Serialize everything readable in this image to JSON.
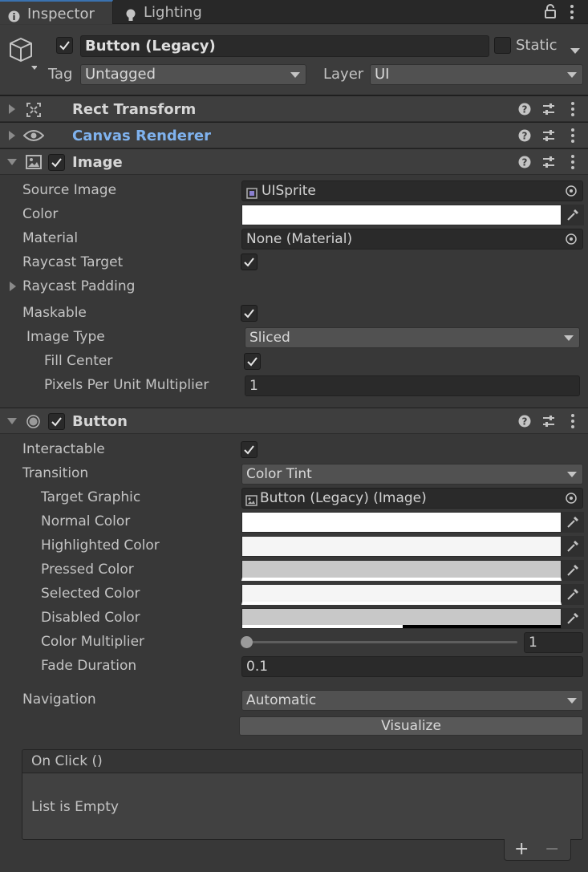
{
  "tabs": [
    {
      "label": "Inspector",
      "icon": "info-icon",
      "active": true
    },
    {
      "label": "Lighting",
      "icon": "bulb-icon",
      "active": false
    }
  ],
  "object": {
    "name": "Button (Legacy)",
    "static_label": "Static",
    "tag_label": "Tag",
    "tag_value": "Untagged",
    "layer_label": "Layer",
    "layer_value": "UI"
  },
  "components": {
    "rect_transform": {
      "title": "Rect Transform"
    },
    "canvas_renderer": {
      "title": "Canvas Renderer"
    },
    "image": {
      "title": "Image",
      "source_image_label": "Source Image",
      "source_image_value": "UISprite",
      "color_label": "Color",
      "material_label": "Material",
      "material_value": "None (Material)",
      "raycast_target_label": "Raycast Target",
      "raycast_padding_label": "Raycast Padding",
      "maskable_label": "Maskable",
      "image_type_label": "Image Type",
      "image_type_value": "Sliced",
      "fill_center_label": "Fill Center",
      "ppu_label": "Pixels Per Unit Multiplier",
      "ppu_value": "1"
    },
    "button": {
      "title": "Button",
      "interactable_label": "Interactable",
      "transition_label": "Transition",
      "transition_value": "Color Tint",
      "target_graphic_label": "Target Graphic",
      "target_graphic_value": "Button (Legacy) (Image)",
      "normal_color_label": "Normal Color",
      "highlighted_color_label": "Highlighted Color",
      "pressed_color_label": "Pressed Color",
      "selected_color_label": "Selected Color",
      "disabled_color_label": "Disabled Color",
      "color_multiplier_label": "Color Multiplier",
      "color_multiplier_value": "1",
      "fade_duration_label": "Fade Duration",
      "fade_duration_value": "0.1",
      "navigation_label": "Navigation",
      "navigation_value": "Automatic",
      "visualize_label": "Visualize",
      "onclick_title": "On Click ()",
      "onclick_empty": "List is Empty",
      "add_label": "+",
      "remove_label": "−"
    }
  },
  "colors": {
    "normal": "#FFFFFF",
    "highlighted": "#F5F5F5",
    "pressed": "#C8C8C8",
    "selected": "#F5F5F5",
    "disabled": "#C8C8C8",
    "canvas_renderer_title": "#7fb2ee",
    "accent": "#3a72b0"
  }
}
